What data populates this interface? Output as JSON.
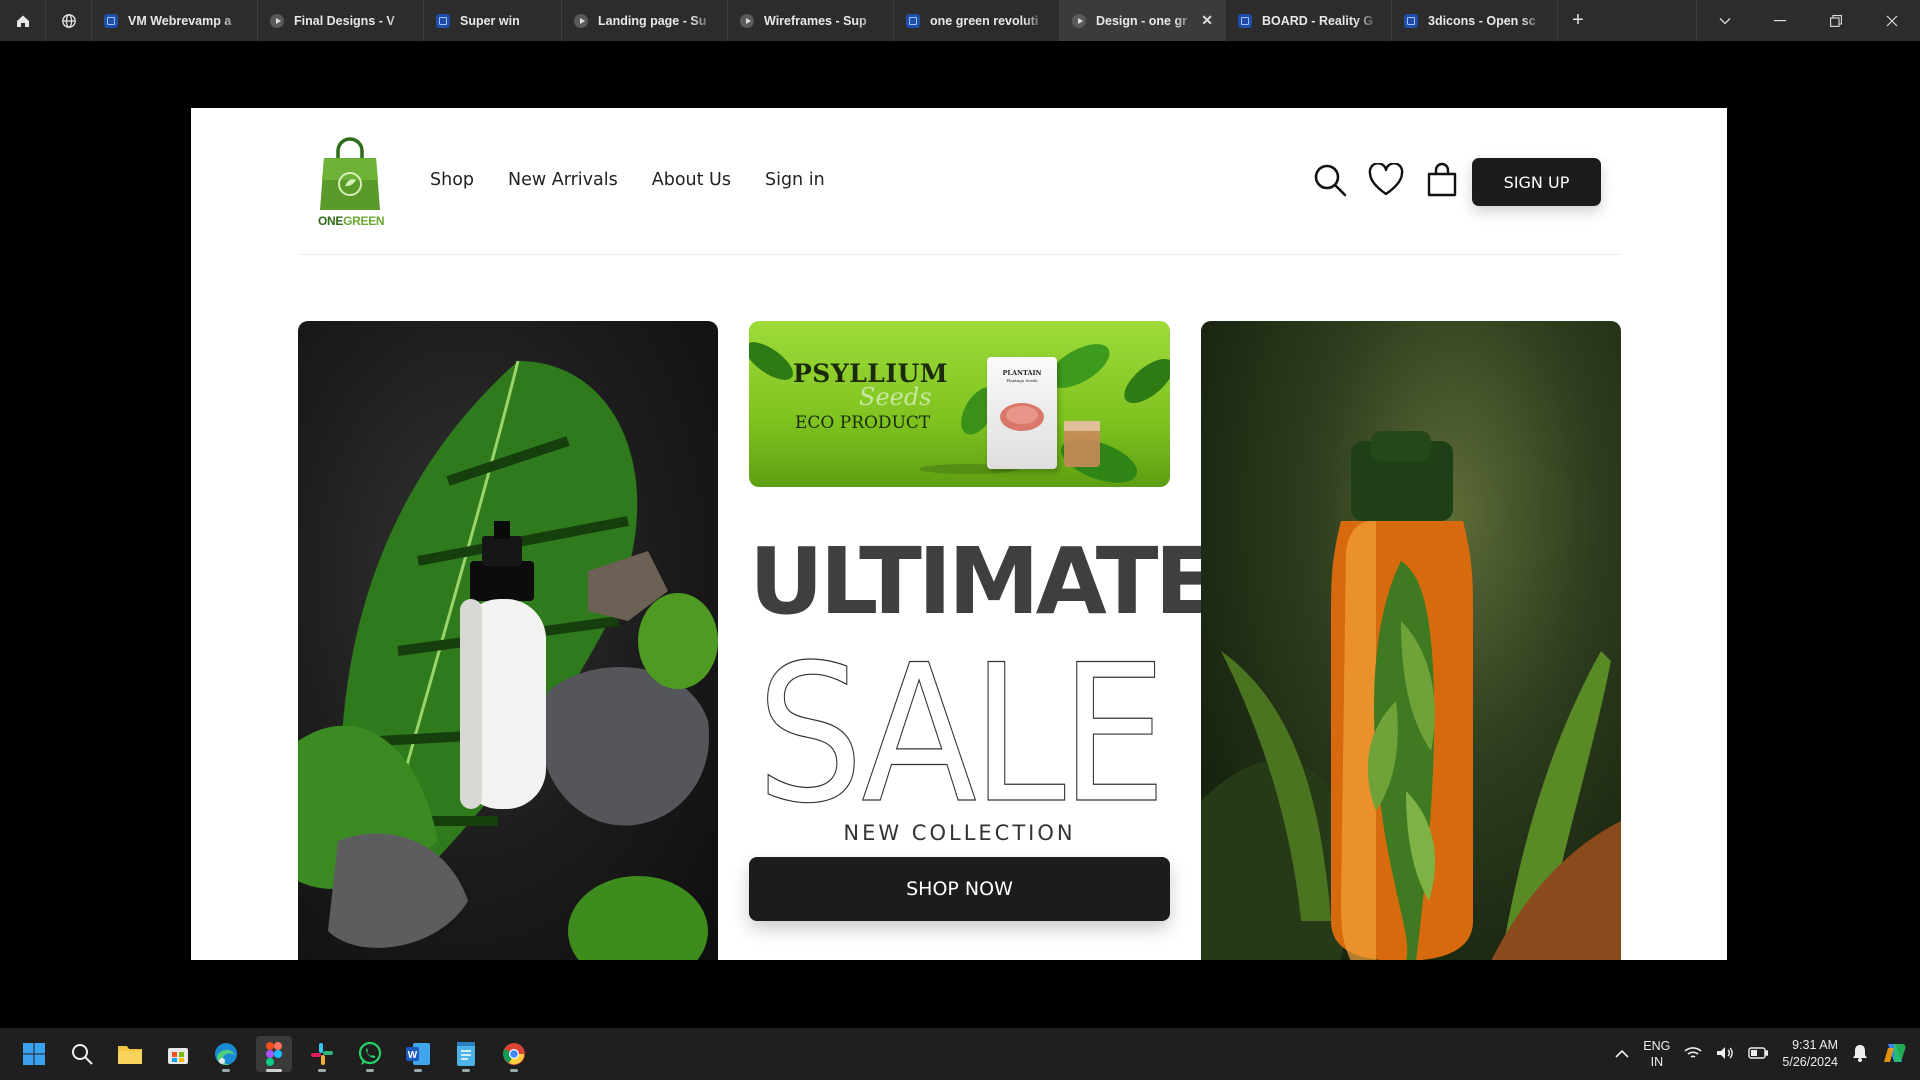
{
  "browser": {
    "tabs": [
      {
        "title": "VM Webrevamp a",
        "favicon": "figma-file-icon"
      },
      {
        "title": "Final Designs - V",
        "favicon": "prototype-play-icon"
      },
      {
        "title": "Super win",
        "favicon": "figma-file-icon"
      },
      {
        "title": "Landing page - Su",
        "favicon": "prototype-play-icon"
      },
      {
        "title": "Wireframes - Sup",
        "favicon": "prototype-play-icon"
      },
      {
        "title": "one green revoluti",
        "favicon": "figma-file-icon"
      },
      {
        "title": "Design - one gr",
        "favicon": "prototype-play-icon",
        "active": true
      },
      {
        "title": "BOARD - Reality G",
        "favicon": "figma-file-icon"
      },
      {
        "title": "3dicons - Open sc",
        "favicon": "figma-file-icon"
      }
    ],
    "add_tab": "+"
  },
  "site": {
    "logo_text_dark": "ONE",
    "logo_text_light": "GREEN",
    "nav": [
      "Shop",
      "New Arrivals",
      "About Us",
      "Sign in"
    ],
    "icons": [
      "search-icon",
      "heart-icon",
      "bag-icon"
    ],
    "signup": "SIGN UP",
    "banner": {
      "title": "PSYLLIUM",
      "script": "Seeds",
      "subtitle": "ECO PRODUCT",
      "pack_title": "PLANTAIN",
      "pack_sub": "Plantago Seeds"
    },
    "headline": "ULTIMATE",
    "sale": "SALE",
    "collection": "NEW COLLECTION",
    "cta": "SHOP NOW"
  },
  "taskbar": {
    "apps": [
      "windows-start-icon",
      "search-icon",
      "file-explorer-icon",
      "store-icon",
      "edge-icon",
      "figma-icon",
      "slack-icon",
      "whatsapp-icon",
      "word-icon",
      "notepad-icon",
      "chrome-icon"
    ],
    "lang_top": "ENG",
    "lang_bottom": "IN",
    "time": "9:31 AM",
    "date": "5/26/2024"
  },
  "colors": {
    "brand_green": "#2f6b18",
    "accent_green": "#7fc320",
    "button_dark": "#1c1c1c"
  }
}
